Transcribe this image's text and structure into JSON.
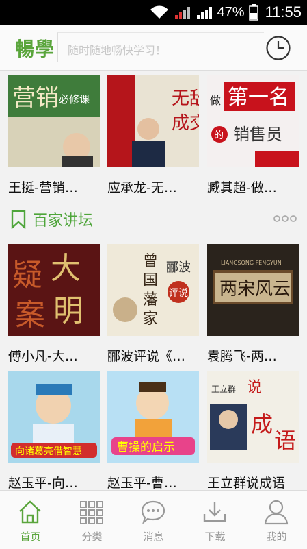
{
  "status_bar": {
    "battery": "47%",
    "time": "11:55"
  },
  "header": {
    "logo": "暢學",
    "search_placeholder": "随时随地畅快学习！"
  },
  "rows": [
    {
      "items": [
        {
          "title": "王挺-营销…",
          "cover_text": "营销必修课"
        },
        {
          "title": "应承龙-无…",
          "cover_text": "无敌成交"
        },
        {
          "title": "臧其超-做…",
          "cover_text": "做第一名的销售员"
        }
      ]
    },
    {
      "items": [
        {
          "title": "傅小凡-大…",
          "cover_text": "大明疑案"
        },
        {
          "title": "郦波评说《…",
          "cover_text": "曾国藩家训 郦波评说"
        },
        {
          "title": "袁腾飞-两…",
          "cover_text": "两宋风云"
        }
      ]
    },
    {
      "items": [
        {
          "title": "赵玉平-向…",
          "cover_text": "向诸葛亮借智慧"
        },
        {
          "title": "赵玉平-曹…",
          "cover_text": "曹操的启示"
        },
        {
          "title": "王立群说成语",
          "cover_text": "王立群说成语"
        }
      ]
    }
  ],
  "section": {
    "title": "百家讲坛"
  },
  "tabs": [
    {
      "label": "首页",
      "icon": "home-icon",
      "active": true
    },
    {
      "label": "分类",
      "icon": "grid-icon",
      "active": false
    },
    {
      "label": "消息",
      "icon": "chat-bubble-icon",
      "active": false
    },
    {
      "label": "下载",
      "icon": "download-icon",
      "active": false
    },
    {
      "label": "我的",
      "icon": "user-icon",
      "active": false
    }
  ],
  "colors": {
    "accent": "#5aa53c",
    "inactive": "#999999"
  }
}
